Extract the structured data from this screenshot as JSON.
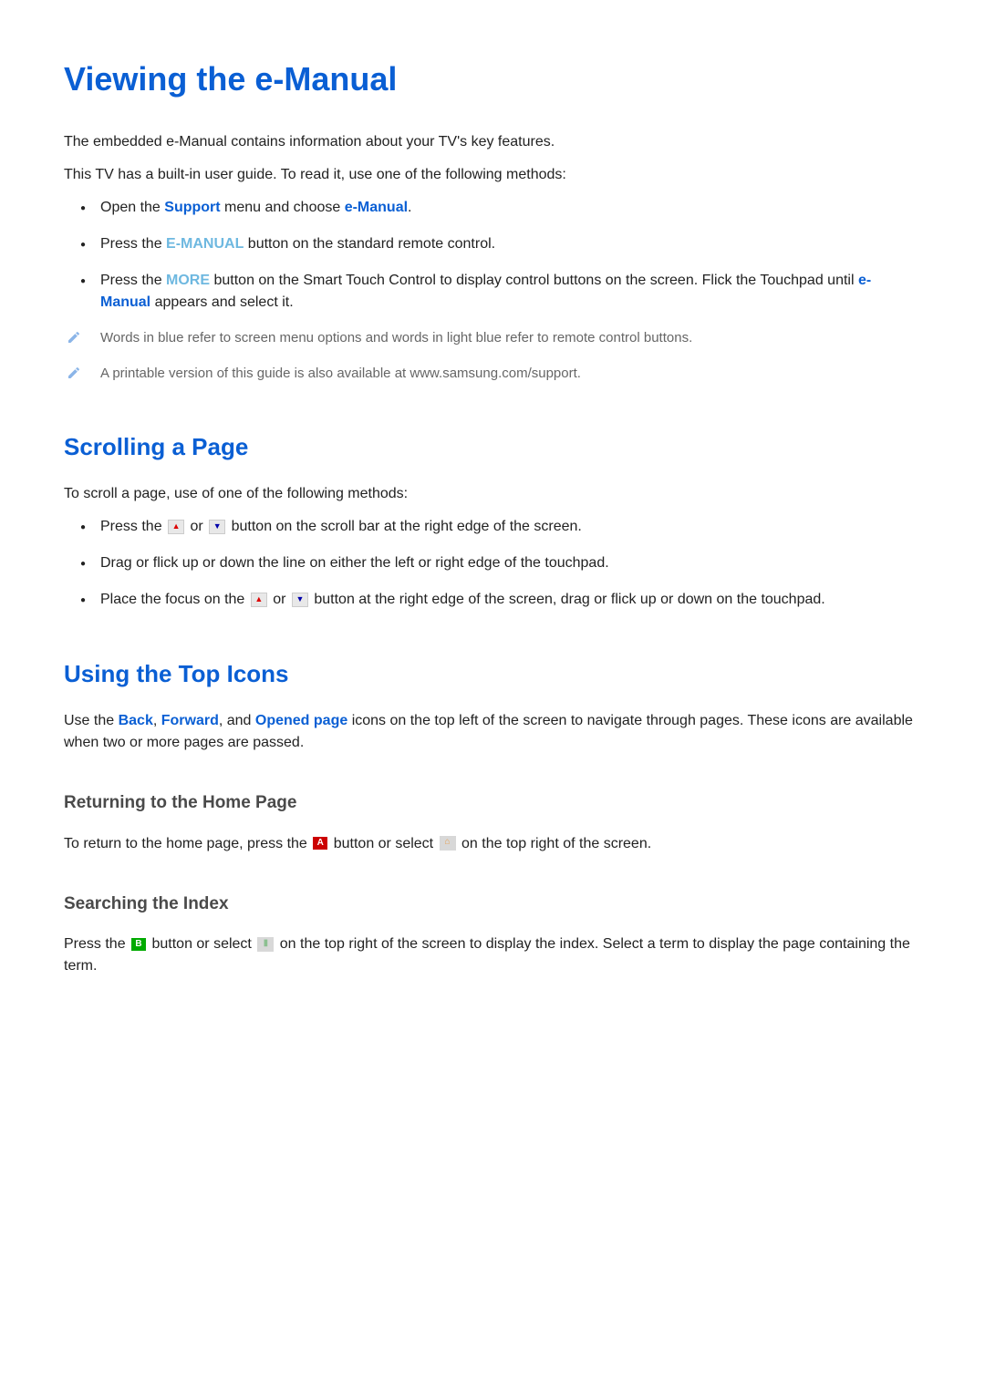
{
  "title": "Viewing the e-Manual",
  "intro": {
    "line1": "The embedded e-Manual contains information about your TV's key features.",
    "line2": "This TV has a built-in user guide. To read it, use one of the following methods:"
  },
  "methods": {
    "item1_a": "Open the ",
    "item1_support": "Support",
    "item1_b": " menu and choose ",
    "item1_emanual": "e-Manual",
    "item1_c": ".",
    "item2_a": "Press the ",
    "item2_emanual": "E-MANUAL",
    "item2_b": " button on the standard remote control.",
    "item3_a": "Press the ",
    "item3_more": "MORE",
    "item3_b": " button on the Smart Touch Control to display control buttons on the screen. Flick the Touchpad until ",
    "item3_emanual": "e-Manual",
    "item3_c": " appears and select it."
  },
  "notes": {
    "note1": "Words in blue refer to screen menu options and words in light blue refer to remote control buttons.",
    "note2": "A printable version of this guide is also available at www.samsung.com/support."
  },
  "scrolling": {
    "heading": "Scrolling a Page",
    "intro": "To scroll a page, use of one of the following methods:",
    "item1_a": "Press the ",
    "item1_b": " or ",
    "item1_c": " button on the scroll bar at the right edge of the screen.",
    "item2": "Drag or flick up or down the line on either the left or right edge of the touchpad.",
    "item3_a": "Place the focus on the ",
    "item3_b": " or ",
    "item3_c": " button at the right edge of the screen, drag or flick up or down on the touchpad."
  },
  "topicons": {
    "heading": "Using the Top Icons",
    "text_a": "Use the ",
    "back": "Back",
    "text_b": ", ",
    "forward": "Forward",
    "text_c": ", and ",
    "opened": "Opened page",
    "text_d": " icons on the top left of the screen to navigate through pages. These icons are available when two or more pages are passed."
  },
  "returning": {
    "heading": "Returning to the Home Page",
    "text_a": "To return to the home page, press the ",
    "text_b": " button or select ",
    "text_c": " on the top right of the screen."
  },
  "searching": {
    "heading": "Searching the Index",
    "text_a": "Press the ",
    "text_b": " button or select ",
    "text_c": " on the top right of the screen to display the index. Select a term to display the page containing the term."
  },
  "labels": {
    "A": "A",
    "B": "B"
  }
}
